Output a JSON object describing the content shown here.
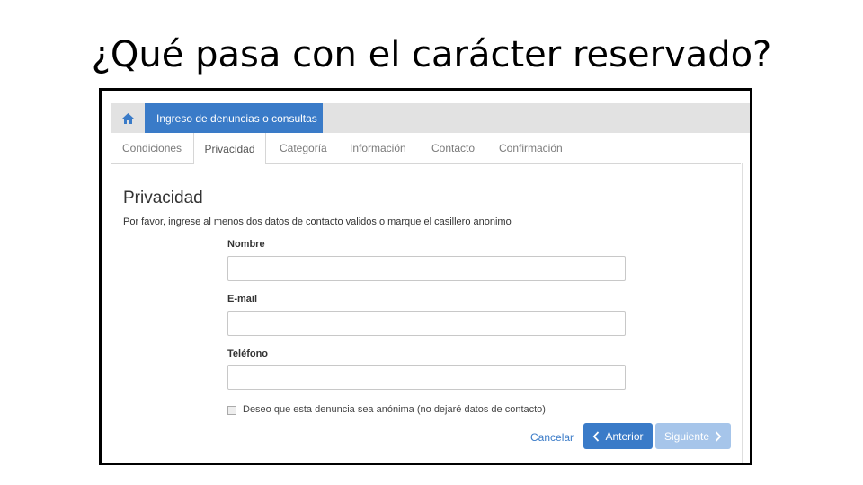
{
  "slide": {
    "title": "¿Qué pasa con el carácter reservado?"
  },
  "app": {
    "header_tab": "Ingreso de denuncias o consultas",
    "steps": [
      "Condiciones",
      "Privacidad",
      "Categoría",
      "Información",
      "Contacto",
      "Confirmación"
    ],
    "active_step": "Privacidad"
  },
  "form": {
    "title": "Privacidad",
    "description": "Por favor, ingrese al menos dos datos de contacto validos o marque el casillero anonimo",
    "fields": [
      {
        "label": "Nombre",
        "value": ""
      },
      {
        "label": "E-mail",
        "value": ""
      },
      {
        "label": "Teléfono",
        "value": ""
      }
    ],
    "anonymous_checkbox": {
      "label": "Deseo que esta denuncia sea anónima (no dejaré datos de contacto)",
      "checked": false
    },
    "buttons": {
      "cancel": "Cancelar",
      "previous": "Anterior",
      "next": "Siguiente"
    }
  },
  "colors": {
    "primary": "#3a7bc8",
    "disabled_primary": "#a6c5ea",
    "header_bg": "#e2e2e2"
  },
  "icons": {
    "home": "home-icon",
    "previous": "chevron-left-icon",
    "next": "chevron-right-icon"
  }
}
